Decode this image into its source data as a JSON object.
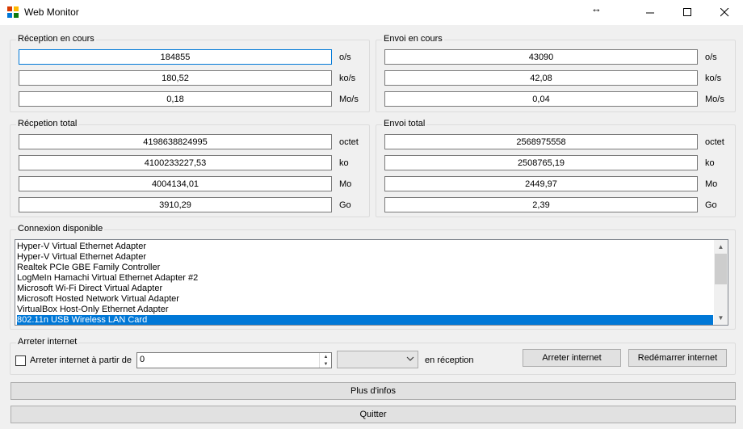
{
  "window": {
    "title": "Web Monitor",
    "resize_glyph": "↔"
  },
  "reception_current": {
    "label": "Réception en cours",
    "rows": [
      {
        "value": "184855",
        "unit": "o/s"
      },
      {
        "value": "180,52",
        "unit": "ko/s"
      },
      {
        "value": "0,18",
        "unit": "Mo/s"
      }
    ]
  },
  "send_current": {
    "label": "Envoi en cours",
    "rows": [
      {
        "value": "43090",
        "unit": "o/s"
      },
      {
        "value": "42,08",
        "unit": "ko/s"
      },
      {
        "value": "0,04",
        "unit": "Mo/s"
      }
    ]
  },
  "reception_total": {
    "label": "Récpetion total",
    "rows": [
      {
        "value": "4198638824995",
        "unit": "octet"
      },
      {
        "value": "4100233227,53",
        "unit": "ko"
      },
      {
        "value": "4004134,01",
        "unit": "Mo"
      },
      {
        "value": "3910,29",
        "unit": "Go"
      }
    ]
  },
  "send_total": {
    "label": "Envoi total",
    "rows": [
      {
        "value": "2568975558",
        "unit": "octet"
      },
      {
        "value": "2508765,19",
        "unit": "ko"
      },
      {
        "value": "2449,97",
        "unit": "Mo"
      },
      {
        "value": "2,39",
        "unit": "Go"
      }
    ]
  },
  "connections": {
    "label": "Connexion disponible",
    "items": [
      "Hyper-V Virtual Ethernet Adapter",
      "Hyper-V Virtual Ethernet Adapter",
      "Realtek PCIe GBE Family Controller",
      "LogMeIn Hamachi Virtual Ethernet Adapter #2",
      "Microsoft Wi-Fi Direct Virtual Adapter",
      "Microsoft Hosted Network Virtual Adapter",
      "VirtualBox Host-Only Ethernet Adapter",
      "802.11n USB Wireless LAN Card"
    ],
    "selected_index": 7
  },
  "stop_internet": {
    "label": "Arreter internet",
    "checkbox_label": "Arreter internet à partir de",
    "checked": false,
    "threshold_value": "0",
    "unit_selected": "",
    "direction_label": "en réception",
    "stop_button": "Arreter internet",
    "restart_button": "Redémarrer internet"
  },
  "buttons": {
    "more_info": "Plus d'infos",
    "quit": "Quitter"
  },
  "colors": {
    "selection": "#0078d7",
    "window_bg": "#f0f0f0",
    "focus_border": "#0078d7"
  }
}
